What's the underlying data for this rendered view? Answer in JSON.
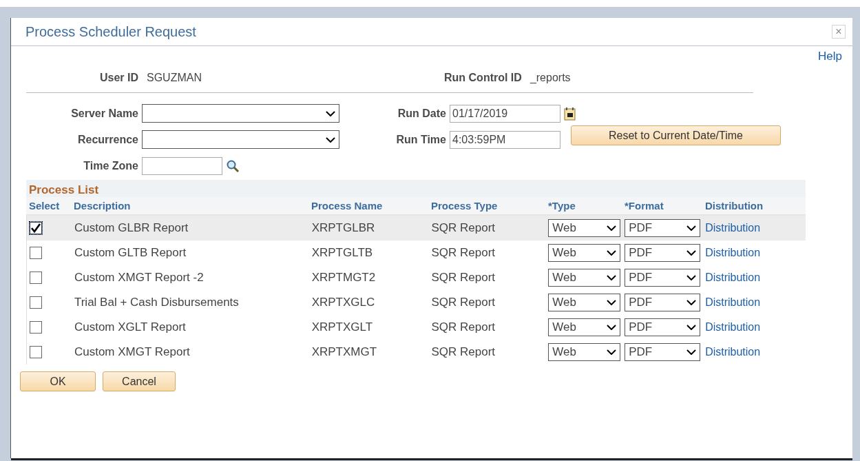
{
  "window": {
    "title": "Process Scheduler Request",
    "close": "×",
    "help": "Help"
  },
  "header": {
    "user_id_label": "User ID",
    "user_id": "SGUZMAN",
    "run_control_label": "Run Control ID",
    "run_control_id": "_reports"
  },
  "form": {
    "server_name_label": "Server Name",
    "recurrence_label": "Recurrence",
    "time_zone_label": "Time Zone",
    "run_date_label": "Run Date",
    "run_date": "01/17/2019",
    "run_time_label": "Run Time",
    "run_time": "4:03:59PM",
    "reset_button": "Reset to Current Date/Time"
  },
  "process_list": {
    "title": "Process List",
    "columns": [
      "Select",
      "Description",
      "Process Name",
      "Process Type",
      "*Type",
      "*Format",
      "Distribution"
    ],
    "rows": [
      {
        "selected": true,
        "checked": true,
        "description": "Custom GLBR Report",
        "process_name": "XRPTGLBR",
        "process_type": "SQR Report",
        "type": "Web",
        "format": "PDF",
        "distribution": "Distribution"
      },
      {
        "selected": false,
        "checked": false,
        "description": "Custom GLTB Report",
        "process_name": "XRPTGLTB",
        "process_type": "SQR Report",
        "type": "Web",
        "format": "PDF",
        "distribution": "Distribution"
      },
      {
        "selected": false,
        "checked": false,
        "description": "Custom XMGT Report -2",
        "process_name": "XRPTMGT2",
        "process_type": "SQR Report",
        "type": "Web",
        "format": "PDF",
        "distribution": "Distribution"
      },
      {
        "selected": false,
        "checked": false,
        "description": "Trial Bal + Cash Disbursements",
        "process_name": "XRPTXGLC",
        "process_type": "SQR Report",
        "type": "Web",
        "format": "PDF",
        "distribution": "Distribution"
      },
      {
        "selected": false,
        "checked": false,
        "description": "Custom XGLT Report",
        "process_name": "XRPTXGLT",
        "process_type": "SQR Report",
        "type": "Web",
        "format": "PDF",
        "distribution": "Distribution"
      },
      {
        "selected": false,
        "checked": false,
        "description": "Custom XMGT Report",
        "process_name": "XRPTXMGT",
        "process_type": "SQR Report",
        "type": "Web",
        "format": "PDF",
        "distribution": "Distribution"
      }
    ]
  },
  "buttons": [
    "OK",
    "Cancel"
  ]
}
